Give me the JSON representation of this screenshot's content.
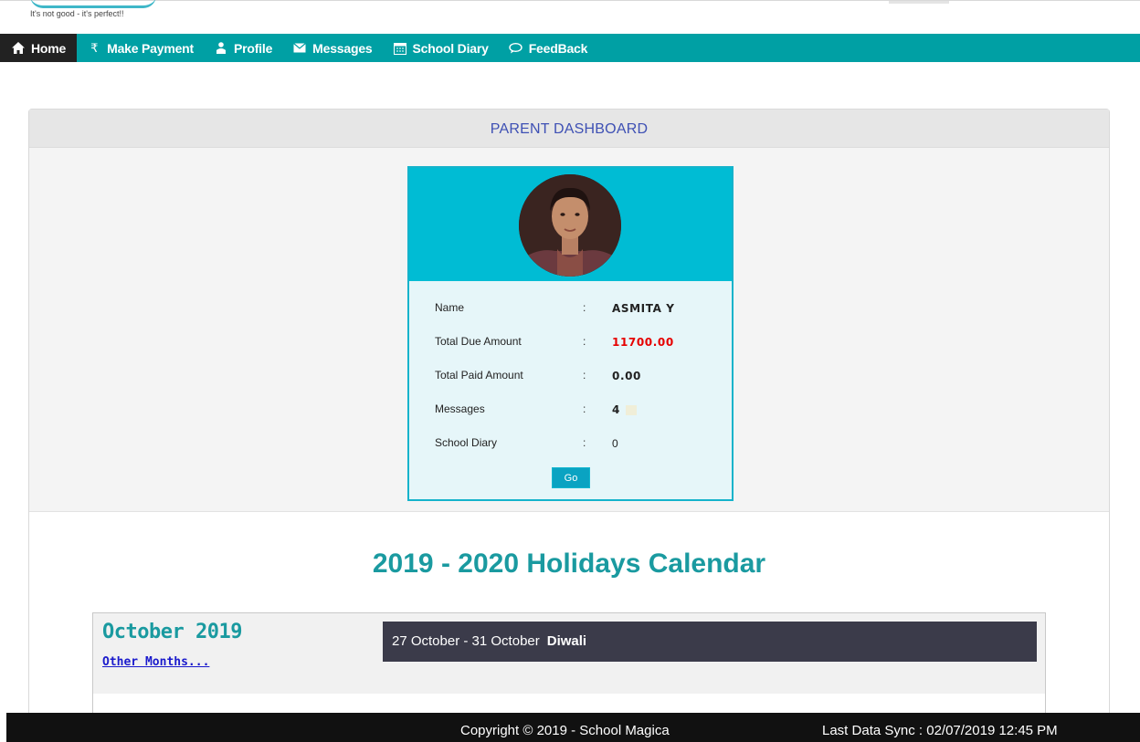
{
  "header": {
    "tagline": "It's not good - it's perfect!!"
  },
  "nav": {
    "items": [
      {
        "label": "Home",
        "icon": "home-icon"
      },
      {
        "label": "Make Payment",
        "icon": "rupee-icon"
      },
      {
        "label": "Profile",
        "icon": "person-icon"
      },
      {
        "label": "Messages",
        "icon": "envelope-icon"
      },
      {
        "label": "School Diary",
        "icon": "calendar-icon"
      },
      {
        "label": "FeedBack",
        "icon": "comment-icon"
      }
    ]
  },
  "dashboard": {
    "title": "PARENT DASHBOARD",
    "rows": [
      {
        "label": "Name",
        "sep": ":",
        "value": "ASMITA Y"
      },
      {
        "label": "Total Due Amount",
        "sep": ":",
        "value": "11700.00"
      },
      {
        "label": "Total Paid Amount",
        "sep": ":",
        "value": "0.00"
      },
      {
        "label": "Messages",
        "sep": ":",
        "value": "4"
      },
      {
        "label": "School Diary",
        "sep": ":",
        "value": "0"
      }
    ],
    "go_label": "Go",
    "due_color": "#e60000"
  },
  "calendar": {
    "title": "2019 - 2020 Holidays Calendar",
    "month": "October 2019",
    "other_months": "Other Months...",
    "holiday_dates": "27 October - 31 October",
    "holiday_name": "Diwali"
  },
  "footer": {
    "copyright": "Copyright © 2019 - School Magica",
    "last_sync": "Last Data Sync : 02/07/2019 12:45 PM"
  },
  "colors": {
    "nav": "#00a0a4",
    "card_top": "#00bcd4",
    "heading": "#1a9aa0"
  }
}
